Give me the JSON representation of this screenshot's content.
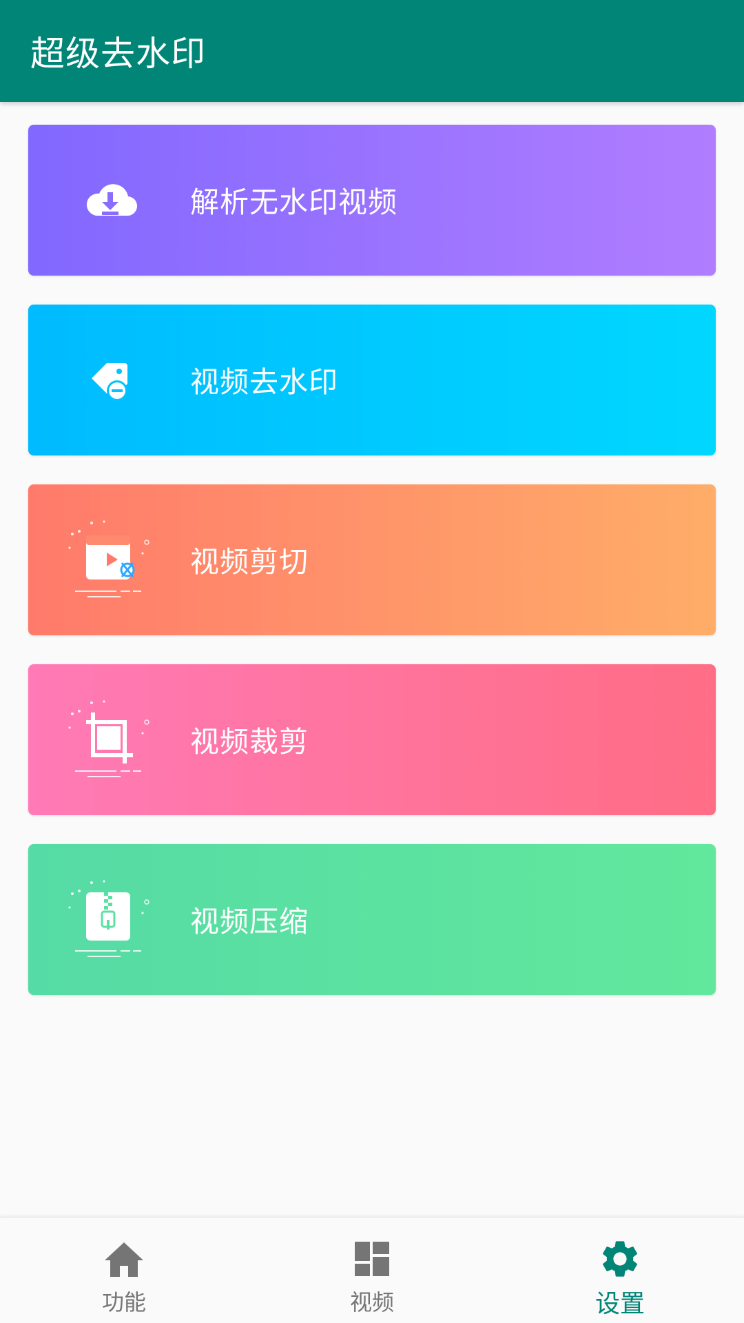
{
  "app_bar": {
    "title": "超级去水印"
  },
  "colors": {
    "primary": "#008577",
    "nav_inactive": "#757575"
  },
  "cards": [
    {
      "label": "解析无水印视频",
      "icon": "cloud-download-icon",
      "gradient": [
        "#8268ff",
        "#b07dff"
      ]
    },
    {
      "label": "视频去水印",
      "icon": "tag-remove-icon",
      "gradient": [
        "#00bbff",
        "#00d7ff"
      ]
    },
    {
      "label": "视频剪切",
      "icon": "video-cut-icon",
      "gradient": [
        "#ff7a6b",
        "#ffad68"
      ]
    },
    {
      "label": "视频裁剪",
      "icon": "crop-icon",
      "gradient": [
        "#ff7ab6",
        "#ff6d85"
      ]
    },
    {
      "label": "视频压缩",
      "icon": "zip-compress-icon",
      "gradient": [
        "#55dba5",
        "#62e89c"
      ]
    }
  ],
  "bottom_nav": {
    "items": [
      {
        "label": "功能",
        "icon": "home-icon",
        "active": false
      },
      {
        "label": "视频",
        "icon": "dashboard-icon",
        "active": false
      },
      {
        "label": "设置",
        "icon": "gear-icon",
        "active": true
      }
    ]
  }
}
